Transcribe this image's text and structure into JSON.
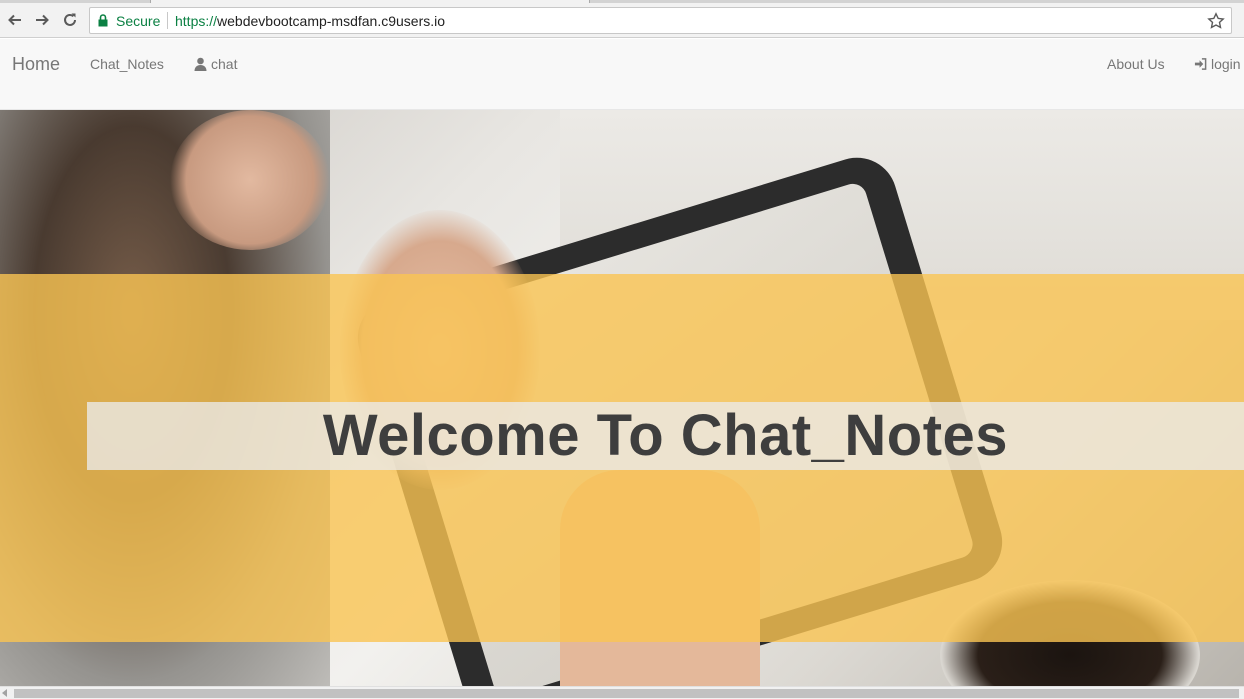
{
  "browser": {
    "secure_label": "Secure",
    "url_scheme": "https://",
    "url_host": "webdevbootcamp-msdfan.c9users.io",
    "icons": [
      "back-arrow-icon",
      "forward-arrow-icon",
      "reload-icon",
      "lock-icon",
      "star-icon"
    ]
  },
  "navbar": {
    "brand": "Home",
    "links_left": [
      {
        "label": "Chat_Notes"
      },
      {
        "label": "chat",
        "icon": "user-icon"
      }
    ],
    "links_right": [
      {
        "label": "About Us"
      },
      {
        "label": "login",
        "icon": "login-icon"
      }
    ]
  },
  "hero": {
    "title": "Welcome To Chat_Notes",
    "band_color": "#fac452"
  }
}
